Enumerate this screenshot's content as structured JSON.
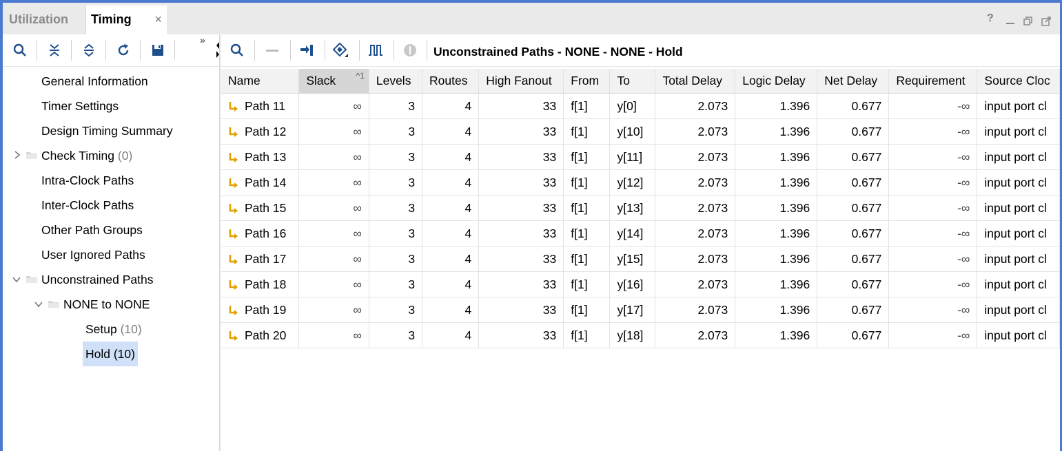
{
  "tabs": [
    {
      "label": "Utilization",
      "active": false
    },
    {
      "label": "Timing",
      "active": true,
      "close": "×"
    }
  ],
  "window_controls": [
    "?",
    "—",
    "restore",
    "float"
  ],
  "left_toolbar": {
    "icons": [
      "search-icon",
      "collapse-all-icon",
      "expand-all-icon",
      "refresh-icon",
      "save-icon"
    ],
    "overflow": "»"
  },
  "right_toolbar": {
    "icons": [
      "search-icon",
      "minus-icon",
      "goto-source-icon",
      "highlight-icon",
      "waveform-icon",
      "stop-icon"
    ],
    "title": "Unconstrained Paths - NONE - NONE - Hold"
  },
  "tree": {
    "items": [
      {
        "label": "General Information",
        "count": ""
      },
      {
        "label": "Timer Settings",
        "count": ""
      },
      {
        "label": "Design Timing Summary",
        "count": ""
      },
      {
        "label": "Check Timing",
        "count": "(0)"
      },
      {
        "label": "Intra-Clock Paths",
        "count": ""
      },
      {
        "label": "Inter-Clock Paths",
        "count": ""
      },
      {
        "label": "Other Path Groups",
        "count": ""
      },
      {
        "label": "User Ignored Paths",
        "count": ""
      },
      {
        "label": "Unconstrained Paths",
        "count": ""
      },
      {
        "label": "NONE to NONE",
        "count": ""
      },
      {
        "label": "Setup",
        "count": "(10)"
      },
      {
        "label": "Hold (10)",
        "count": "",
        "selected": true
      }
    ]
  },
  "table": {
    "columns": [
      "Name",
      "Slack",
      "Levels",
      "Routes",
      "High Fanout",
      "From",
      "To",
      "Total Delay",
      "Logic Delay",
      "Net Delay",
      "Requirement",
      "Source Cloc"
    ],
    "sort_indicator": "^1",
    "rows": [
      {
        "name": "Path 11",
        "slack": "∞",
        "levels": "3",
        "routes": "4",
        "fanout": "33",
        "from": "f[1]",
        "to": "y[0]",
        "total": "2.073",
        "logic": "1.396",
        "net": "0.677",
        "req": "-∞",
        "src": "input port cl"
      },
      {
        "name": "Path 12",
        "slack": "∞",
        "levels": "3",
        "routes": "4",
        "fanout": "33",
        "from": "f[1]",
        "to": "y[10]",
        "total": "2.073",
        "logic": "1.396",
        "net": "0.677",
        "req": "-∞",
        "src": "input port cl"
      },
      {
        "name": "Path 13",
        "slack": "∞",
        "levels": "3",
        "routes": "4",
        "fanout": "33",
        "from": "f[1]",
        "to": "y[11]",
        "total": "2.073",
        "logic": "1.396",
        "net": "0.677",
        "req": "-∞",
        "src": "input port cl"
      },
      {
        "name": "Path 14",
        "slack": "∞",
        "levels": "3",
        "routes": "4",
        "fanout": "33",
        "from": "f[1]",
        "to": "y[12]",
        "total": "2.073",
        "logic": "1.396",
        "net": "0.677",
        "req": "-∞",
        "src": "input port cl"
      },
      {
        "name": "Path 15",
        "slack": "∞",
        "levels": "3",
        "routes": "4",
        "fanout": "33",
        "from": "f[1]",
        "to": "y[13]",
        "total": "2.073",
        "logic": "1.396",
        "net": "0.677",
        "req": "-∞",
        "src": "input port cl"
      },
      {
        "name": "Path 16",
        "slack": "∞",
        "levels": "3",
        "routes": "4",
        "fanout": "33",
        "from": "f[1]",
        "to": "y[14]",
        "total": "2.073",
        "logic": "1.396",
        "net": "0.677",
        "req": "-∞",
        "src": "input port cl"
      },
      {
        "name": "Path 17",
        "slack": "∞",
        "levels": "3",
        "routes": "4",
        "fanout": "33",
        "from": "f[1]",
        "to": "y[15]",
        "total": "2.073",
        "logic": "1.396",
        "net": "0.677",
        "req": "-∞",
        "src": "input port cl"
      },
      {
        "name": "Path 18",
        "slack": "∞",
        "levels": "3",
        "routes": "4",
        "fanout": "33",
        "from": "f[1]",
        "to": "y[16]",
        "total": "2.073",
        "logic": "1.396",
        "net": "0.677",
        "req": "-∞",
        "src": "input port cl"
      },
      {
        "name": "Path 19",
        "slack": "∞",
        "levels": "3",
        "routes": "4",
        "fanout": "33",
        "from": "f[1]",
        "to": "y[17]",
        "total": "2.073",
        "logic": "1.396",
        "net": "0.677",
        "req": "-∞",
        "src": "input port cl"
      },
      {
        "name": "Path 20",
        "slack": "∞",
        "levels": "3",
        "routes": "4",
        "fanout": "33",
        "from": "f[1]",
        "to": "y[18]",
        "total": "2.073",
        "logic": "1.396",
        "net": "0.677",
        "req": "-∞",
        "src": "input port cl"
      }
    ]
  },
  "colors": {
    "accent": "#4a7bd0",
    "toolbar_icon": "#1f4e8c",
    "path_icon": "#e0a000",
    "selection": "#cfe0f8"
  }
}
